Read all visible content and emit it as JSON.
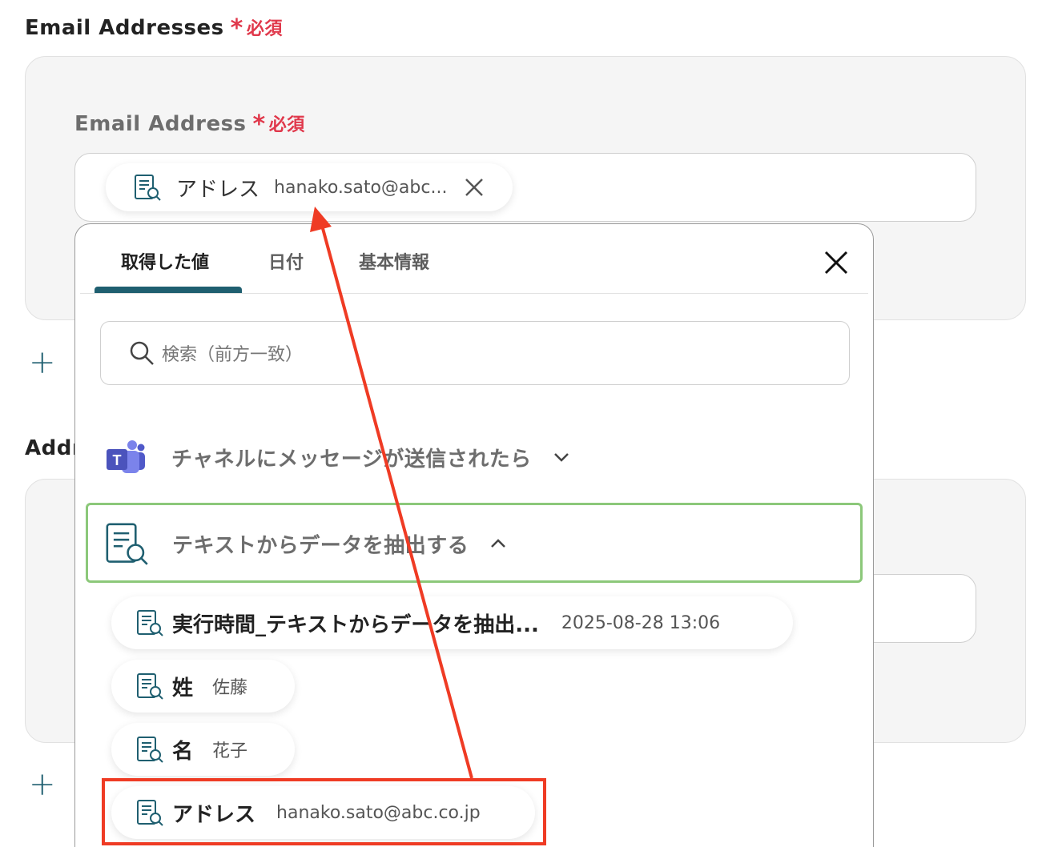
{
  "fields": {
    "email_addresses": {
      "label": "Email Addresses",
      "required_text": "必須"
    },
    "email_address": {
      "label": "Email Address",
      "required_text": "必須"
    },
    "second_label_partial": "Addr"
  },
  "selected_chip": {
    "name": "アドレス",
    "value": "hanako.sato@abc..."
  },
  "popup": {
    "tabs": [
      {
        "label": "取得した値",
        "active": true
      },
      {
        "label": "日付",
        "active": false
      },
      {
        "label": "基本情報",
        "active": false
      }
    ],
    "search_placeholder": "検索（前方一致）",
    "groups": [
      {
        "title": "チャネルにメッセージが送信されたら",
        "icon": "teams-icon",
        "expanded": false
      },
      {
        "title": "テキストからデータを抽出する",
        "icon": "text-extract-icon",
        "expanded": true
      }
    ],
    "items": [
      {
        "name": "実行時間_テキストからデータを抽出...",
        "value": "2025-08-28 13:06"
      },
      {
        "name": "姓",
        "value": "佐藤"
      },
      {
        "name": "名",
        "value": "花子"
      },
      {
        "name": "アドレス",
        "value": "hanako.sato@abc.co.jp"
      }
    ]
  },
  "colors": {
    "accent": "#1f5f70",
    "required": "#e0384b",
    "annotation_red": "#ef3b24",
    "group_highlight": "#8cc87a"
  }
}
